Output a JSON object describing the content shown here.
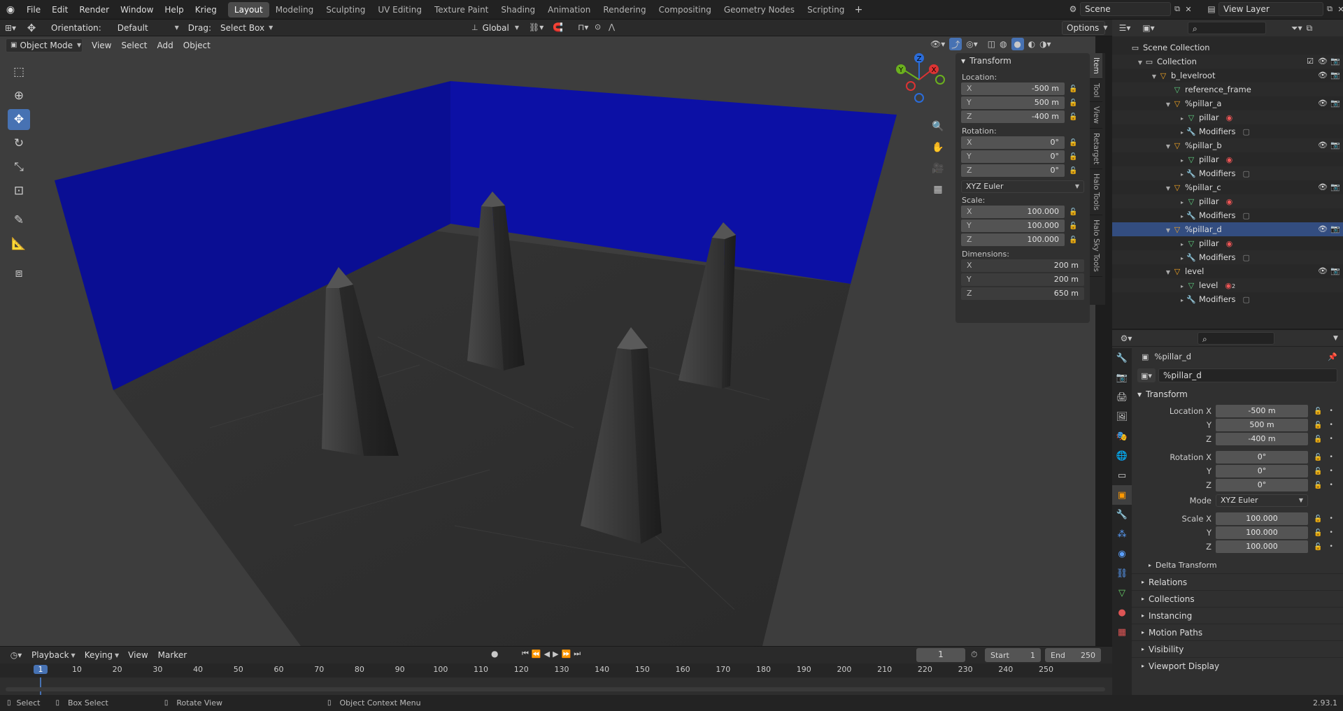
{
  "menus": [
    "File",
    "Edit",
    "Render",
    "Window",
    "Help",
    "Krieg"
  ],
  "workspaces": [
    "Layout",
    "Modeling",
    "Sculpting",
    "UV Editing",
    "Texture Paint",
    "Shading",
    "Animation",
    "Rendering",
    "Compositing",
    "Geometry Nodes",
    "Scripting"
  ],
  "active_workspace": "Layout",
  "scene": "Scene",
  "view_layer": "View Layer",
  "tool_header": {
    "orientation_label": "Orientation:",
    "orientation_value": "Default",
    "drag_label": "Drag:",
    "drag_value": "Select Box",
    "transform_orientation": "Global",
    "options": "Options"
  },
  "viewport_header": {
    "mode": "Object Mode",
    "items": [
      "View",
      "Select",
      "Add",
      "Object"
    ]
  },
  "npanel": {
    "title": "Transform",
    "location_label": "Location:",
    "location": {
      "x": "-500 m",
      "y": "500 m",
      "z": "-400 m"
    },
    "rotation_label": "Rotation:",
    "rotation": {
      "x": "0°",
      "y": "0°",
      "z": "0°"
    },
    "rotation_mode": "XYZ Euler",
    "scale_label": "Scale:",
    "scale": {
      "x": "100.000",
      "y": "100.000",
      "z": "100.000"
    },
    "dimensions_label": "Dimensions:",
    "dimensions": {
      "x": "200 m",
      "y": "200 m",
      "z": "650 m"
    },
    "axis": {
      "x": "X",
      "y": "Y",
      "z": "Z"
    },
    "tabs": [
      "Item",
      "Tool",
      "View",
      "Retarget",
      "Halo Tools",
      "Halo Sky Tools"
    ]
  },
  "gizmo": {
    "z": "Z",
    "y": "Y",
    "x": "X"
  },
  "outliner": {
    "rows": [
      {
        "label": "Scene Collection",
        "indent": 0,
        "icon": "scene-collection",
        "eye": false,
        "tri": ""
      },
      {
        "label": "Collection",
        "indent": 1,
        "icon": "collection",
        "eye": false,
        "tri": "▼",
        "check": true
      },
      {
        "label": "b_levelroot",
        "indent": 2,
        "icon": "empty",
        "eye": true,
        "tri": "▼"
      },
      {
        "label": "reference_frame",
        "indent": 3,
        "icon": "mesh",
        "eye": false,
        "tri": ""
      },
      {
        "label": "%pillar_a",
        "indent": 3,
        "icon": "empty",
        "eye": true,
        "tri": "▼"
      },
      {
        "label": "pillar",
        "indent": 4,
        "icon": "mesh",
        "eye": false,
        "tri": "▸",
        "mat": true
      },
      {
        "label": "Modifiers",
        "indent": 4,
        "icon": "wrench",
        "eye": false,
        "tri": "▸",
        "mod": true
      },
      {
        "label": "%pillar_b",
        "indent": 3,
        "icon": "empty",
        "eye": true,
        "tri": "▼"
      },
      {
        "label": "pillar",
        "indent": 4,
        "icon": "mesh",
        "eye": false,
        "tri": "▸",
        "mat": true
      },
      {
        "label": "Modifiers",
        "indent": 4,
        "icon": "wrench",
        "eye": false,
        "tri": "▸",
        "mod": true
      },
      {
        "label": "%pillar_c",
        "indent": 3,
        "icon": "empty",
        "eye": true,
        "tri": "▼"
      },
      {
        "label": "pillar",
        "indent": 4,
        "icon": "mesh",
        "eye": false,
        "tri": "▸",
        "mat": true
      },
      {
        "label": "Modifiers",
        "indent": 4,
        "icon": "wrench",
        "eye": false,
        "tri": "▸",
        "mod": true
      },
      {
        "label": "%pillar_d",
        "indent": 3,
        "icon": "empty",
        "eye": true,
        "tri": "▼",
        "active": true
      },
      {
        "label": "pillar",
        "indent": 4,
        "icon": "mesh",
        "eye": false,
        "tri": "▸",
        "mat": true
      },
      {
        "label": "Modifiers",
        "indent": 4,
        "icon": "wrench",
        "eye": false,
        "tri": "▸",
        "mod": true
      },
      {
        "label": "level",
        "indent": 3,
        "icon": "empty",
        "eye": true,
        "tri": "▼"
      },
      {
        "label": "level",
        "indent": 4,
        "icon": "mesh",
        "eye": false,
        "tri": "▸",
        "mat": true,
        "mat_count": "2"
      },
      {
        "label": "Modifiers",
        "indent": 4,
        "icon": "wrench",
        "eye": false,
        "tri": "▸",
        "mod": true
      }
    ]
  },
  "properties": {
    "object_name": "%pillar_d",
    "object_field": "%pillar_d",
    "transform_title": "Transform",
    "location_x_label": "Location X",
    "location_y_label": "Y",
    "location_z_label": "Z",
    "location": {
      "x": "-500 m",
      "y": "500 m",
      "z": "-400 m"
    },
    "rotation_x_label": "Rotation X",
    "rotation_y_label": "Y",
    "rotation_z_label": "Z",
    "rotation": {
      "x": "0°",
      "y": "0°",
      "z": "0°"
    },
    "mode_label": "Mode",
    "mode": "XYZ Euler",
    "scale_x_label": "Scale X",
    "scale_y_label": "Y",
    "scale_z_label": "Z",
    "scale": {
      "x": "100.000",
      "y": "100.000",
      "z": "100.000"
    },
    "delta": "Delta Transform",
    "sections": [
      "Relations",
      "Collections",
      "Instancing",
      "Motion Paths",
      "Visibility",
      "Viewport Display"
    ]
  },
  "timeline": {
    "menus": [
      "Playback",
      "Keying",
      "View",
      "Marker"
    ],
    "current_frame": "1",
    "start_label": "Start",
    "start": "1",
    "end_label": "End",
    "end": "250",
    "ruler": [
      "1",
      "10",
      "20",
      "30",
      "40",
      "50",
      "60",
      "70",
      "80",
      "90",
      "100",
      "110",
      "120",
      "130",
      "140",
      "150",
      "160",
      "170",
      "180",
      "190",
      "200",
      "210",
      "220",
      "230",
      "240",
      "250"
    ]
  },
  "statusbar": {
    "select": "Select",
    "box_select": "Box Select",
    "rotate_view": "Rotate View",
    "context_menu": "Object Context Menu",
    "version": "2.93.1"
  },
  "colors": {
    "accent": "#4772b3",
    "wall": "#0b0f9a",
    "floor": "#2c2c2c",
    "pillar": "#3a3a3a",
    "selected_row": "#334d80"
  }
}
